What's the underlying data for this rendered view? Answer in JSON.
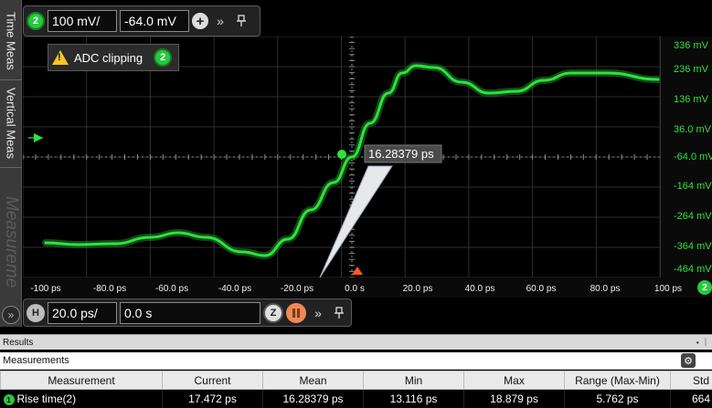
{
  "side_tabs": {
    "time_meas": "Time Meas",
    "vertical_meas": "Vertical Meas",
    "measure": "Measureme"
  },
  "top_toolbar": {
    "channel": "2",
    "scale": "100 mV/",
    "offset": "-64.0 mV",
    "add_icon": "plus-icon",
    "expand_icon": "double-chevron-right-icon",
    "pin_icon": "pin-icon"
  },
  "adc_banner": {
    "text": "ADC clipping",
    "channel": "2"
  },
  "cursor_readout": "16.28379 ps",
  "colors": {
    "trace": "#2de23e",
    "trigger": "#ff5a1f",
    "background": "#000000"
  },
  "v_axis": {
    "labels": [
      "336 mV",
      "236 mV",
      "136 mV",
      "36.0 mV",
      "-64.0 mV",
      "-164 mV",
      "-264 mV",
      "-364 mV",
      "-464 mV"
    ]
  },
  "t_axis": {
    "labels": [
      "-100 ps",
      "-80.0 ps",
      "-60.0 ps",
      "-40.0 ps",
      "-20.0 ps",
      "0.0 s",
      "20.0 ps",
      "40.0 ps",
      "60.0 ps",
      "80.0 ps",
      "100 ps"
    ],
    "channel": "2"
  },
  "h_toolbar": {
    "label": "H",
    "timebase": "20.0 ps/",
    "delay": "0.0 s",
    "zoom": "Z"
  },
  "results": {
    "title": "Results",
    "controls": "▾ ᛁ"
  },
  "measurements": {
    "title": "Measurements",
    "columns": [
      "Measurement",
      "Current",
      "Mean",
      "Min",
      "Max",
      "Range (Max-Min)",
      "Std"
    ],
    "rows": [
      {
        "channel": "1",
        "name": "Rise time(2)",
        "current": "17.472 ps",
        "mean": "16.28379 ps",
        "min": "13.116 ps",
        "max": "18.879 ps",
        "range": "5.762 ps",
        "std": "664"
      }
    ]
  }
}
